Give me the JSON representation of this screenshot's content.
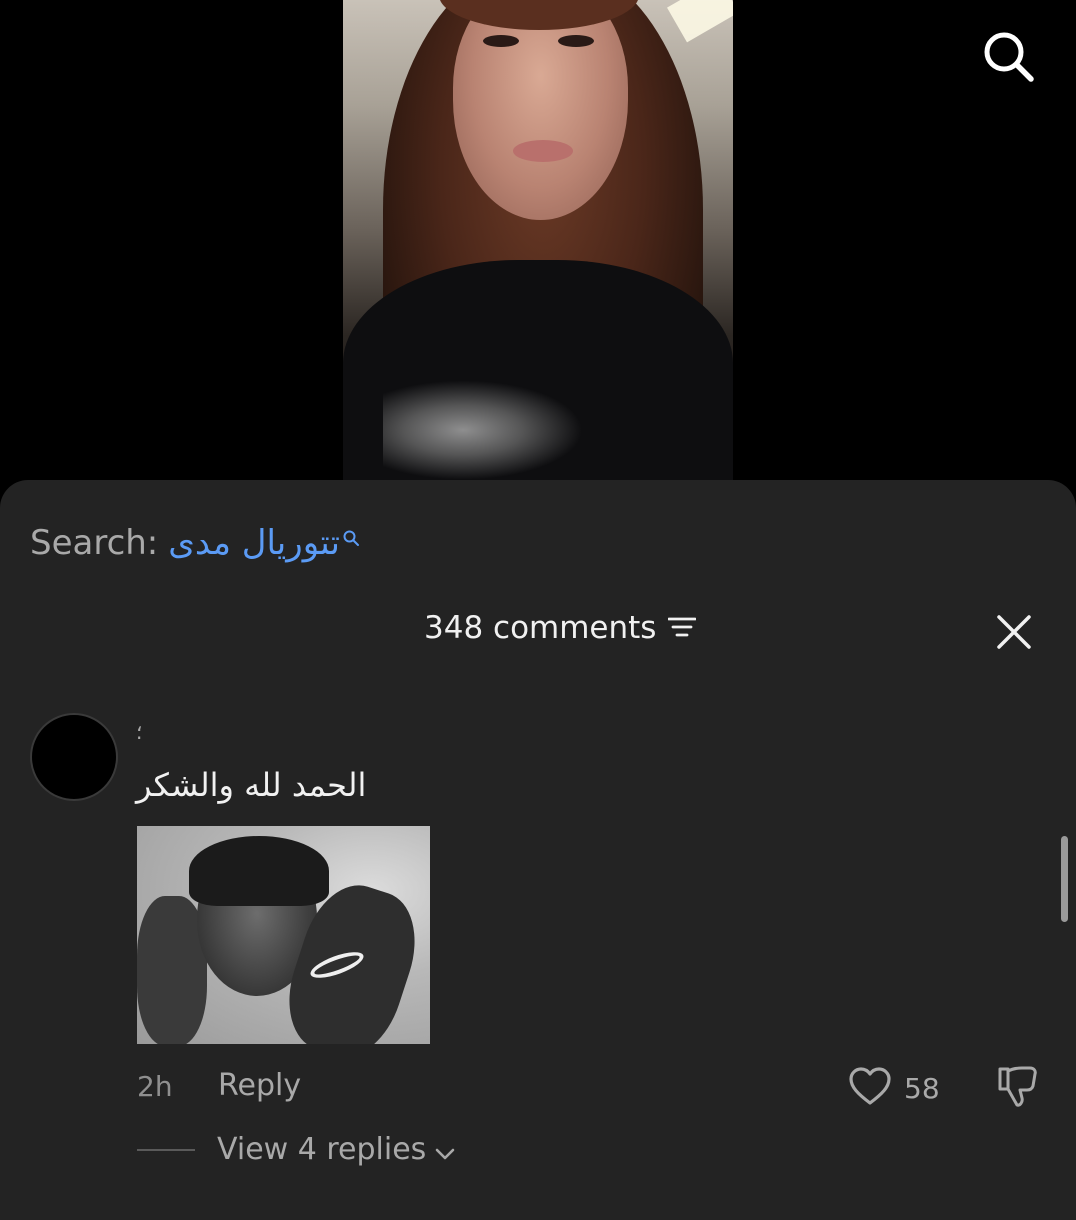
{
  "search": {
    "label": "Search:",
    "term": "تتوريال مدى"
  },
  "header": {
    "comment_count": "348 comments"
  },
  "comment": {
    "username": "؛",
    "text": "الحمد لله والشكر",
    "time": "2h",
    "reply_label": "Reply",
    "like_count": "58",
    "view_replies_label": "View 4 replies"
  },
  "icons": {
    "top_search": "search-icon",
    "search_inline": "search-icon",
    "filter": "filter-icon",
    "close": "close-icon",
    "like": "heart-icon",
    "dislike": "thumbs-down-icon",
    "expand": "chevron-down-icon"
  },
  "colors": {
    "sheet_background": "#232323",
    "search_term": "#5b9bf5",
    "primary_text": "#f1f1f1",
    "secondary_text": "#a9a9a9"
  }
}
